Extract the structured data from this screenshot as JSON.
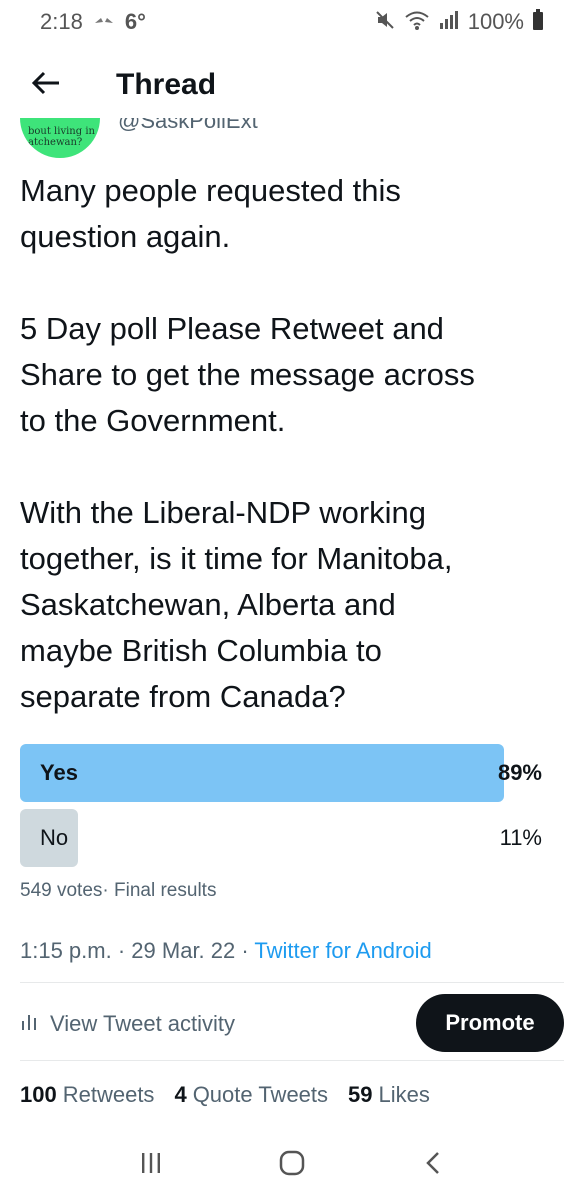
{
  "status_bar": {
    "time": "2:18",
    "temperature": "6°",
    "battery": "100%",
    "icons": [
      "notification-icon",
      "mute-icon",
      "wifi-icon",
      "signal-icon",
      "battery-icon"
    ]
  },
  "header": {
    "title": "Thread",
    "back_icon": "arrow-left-icon"
  },
  "author": {
    "avatar_text": "bout living in\natchewan?",
    "handle": "@SaskPollExt"
  },
  "tweet": {
    "text": "Many people requested this\nquestion again.\n\n5 Day poll Please Retweet and\nShare to get the message across\nto the Government.\n\nWith the Liberal-NDP working\ntogether, is it time for Manitoba,\nSaskatchewan, Alberta and\nmaybe British Columbia to\nseparate from Canada?"
  },
  "poll": {
    "options": [
      {
        "label": "Yes",
        "percent_text": "89%",
        "fraction": 0.89,
        "winner": true
      },
      {
        "label": "No",
        "percent_text": "11%",
        "fraction": 0.11,
        "winner": false
      }
    ],
    "votes": "549 votes",
    "status": "Final results",
    "colors": {
      "winner": "#7cc4f5",
      "other": "#cfd9de"
    }
  },
  "meta": {
    "time": "1:15 p.m.",
    "date": "29 Mar. 22",
    "source": "Twitter for Android"
  },
  "actions": {
    "view_activity": "View Tweet activity",
    "promote": "Promote"
  },
  "stats": {
    "retweets_count": "100",
    "retweets_label": "Retweets",
    "quotes_count": "4",
    "quotes_label": "Quote Tweets",
    "likes_count": "59",
    "likes_label": "Likes"
  },
  "nav": {
    "icons": [
      "recent-apps-icon",
      "home-icon",
      "back-icon"
    ]
  }
}
